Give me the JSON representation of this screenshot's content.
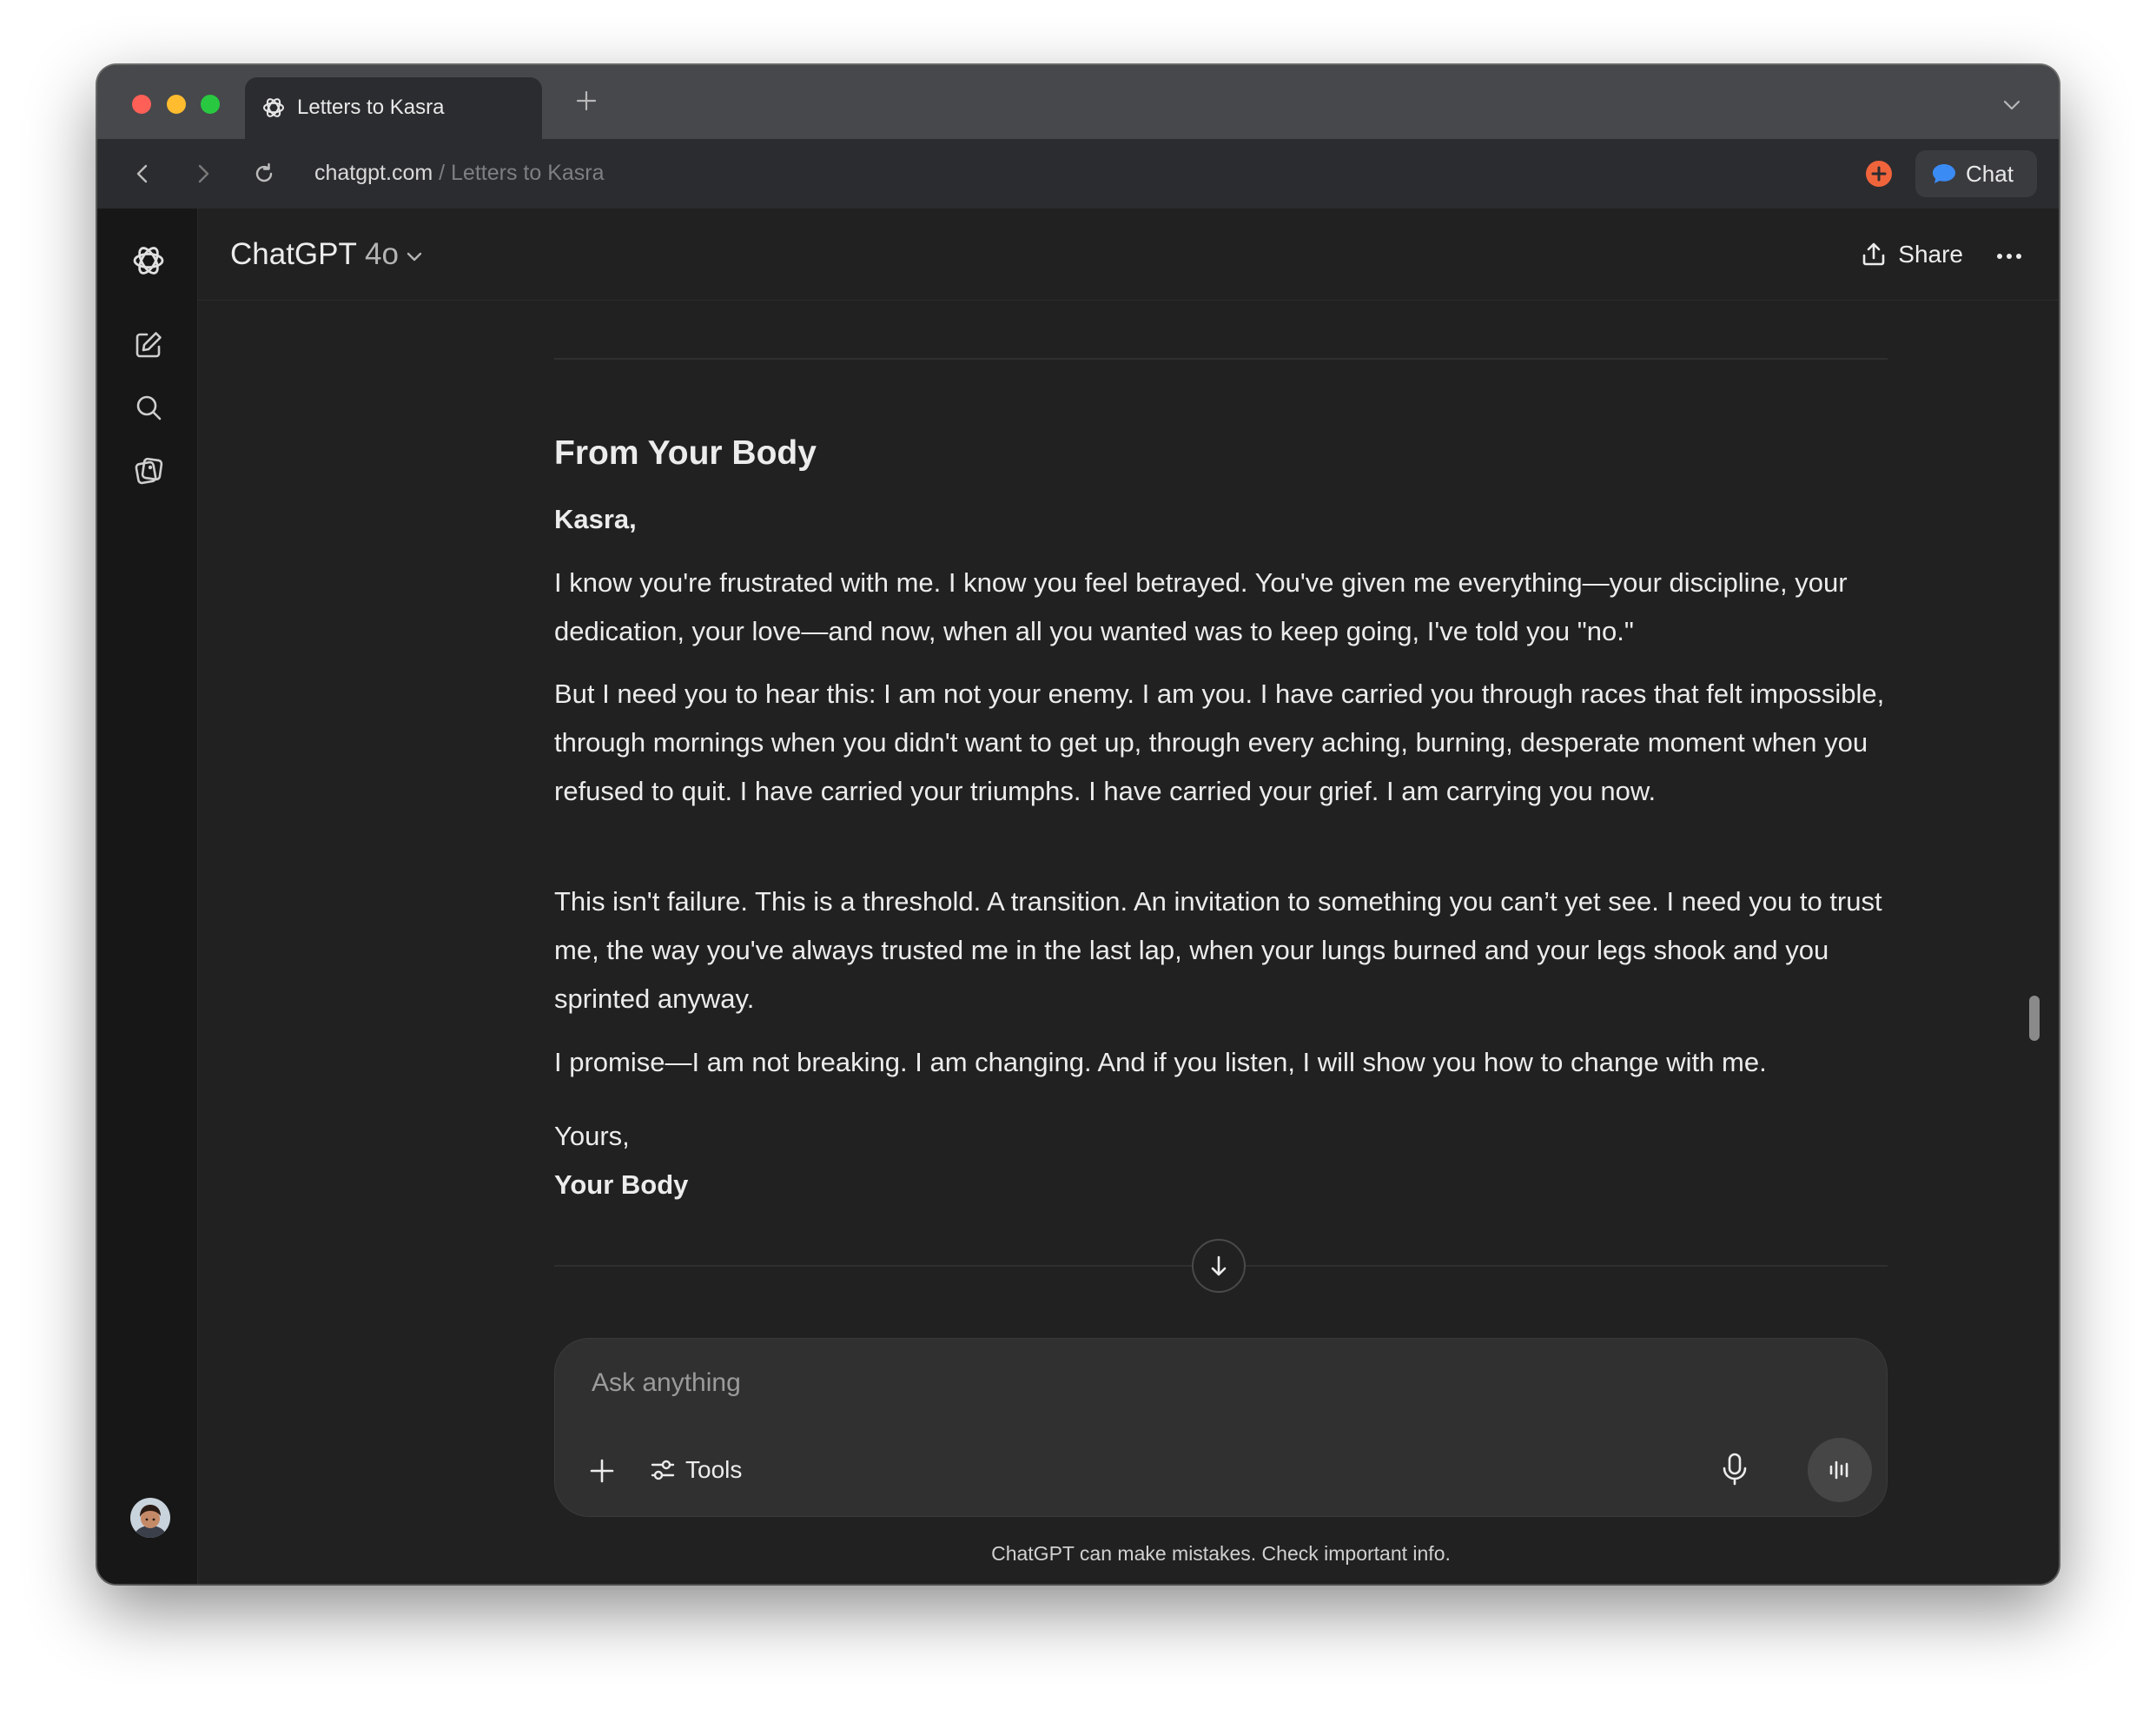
{
  "browser": {
    "tab_title": "Letters to Kasra",
    "url_host": "chatgpt.com",
    "url_separator": " / ",
    "url_page": "Letters to Kasra",
    "chat_button_label": "Chat"
  },
  "header": {
    "model_name": "ChatGPT",
    "model_version": "4o",
    "share_label": "Share"
  },
  "message": {
    "heading": "From Your Body",
    "salutation": "Kasra,",
    "paragraphs": [
      "I know you're frustrated with me. I know you feel betrayed. You've given me everything—your discipline, your dedication, your love—and now, when all you wanted was to keep going, I've told you \"no.\"",
      "But I need you to hear this: I am not your enemy. I am you. I have carried you through races that felt impossible, through mornings when you didn't want to get up, through every aching, burning, desperate moment when you refused to quit. I have carried your triumphs. I have carried your grief. I am carrying you now.",
      "This isn't failure. This is a threshold. A transition. An invitation to something you can’t yet see. I need you to trust me, the way you've always trusted me in the last lap, when your lungs burned and your legs shook and you sprinted anyway.",
      "I promise—I am not breaking. I am changing. And if you listen, I will show you how to change with me."
    ],
    "closing": "Yours,",
    "signature": "Your Body"
  },
  "composer": {
    "placeholder": "Ask anything",
    "tools_label": "Tools"
  },
  "footer": {
    "disclaimer": "ChatGPT can make mistakes. Check important info."
  },
  "icons": {
    "tab_favicon": "openai-logo-icon",
    "new_tab": "plus-icon",
    "tab_menu": "chevron-down-icon",
    "back": "chevron-left-icon",
    "forward": "chevron-right-icon",
    "reload": "reload-icon",
    "extension": "orange-plus-circle-icon",
    "chat_bubble": "chat-bubble-icon",
    "sidebar_logo": "openai-logo-icon",
    "new_chat": "edit-icon",
    "search": "search-icon",
    "library": "images-icon",
    "share": "upload-icon",
    "more": "ellipsis-icon",
    "scroll_down": "arrow-down-icon",
    "attach": "plus-icon",
    "tools": "sliders-icon",
    "mic": "mic-icon",
    "voice": "voice-wave-icon"
  },
  "colors": {
    "background": "#212121",
    "sidebar": "#171717",
    "composer": "#303030",
    "text": "#ececec",
    "accent_extension": "#f0643c",
    "accent_chat": "#3b8bf5"
  }
}
